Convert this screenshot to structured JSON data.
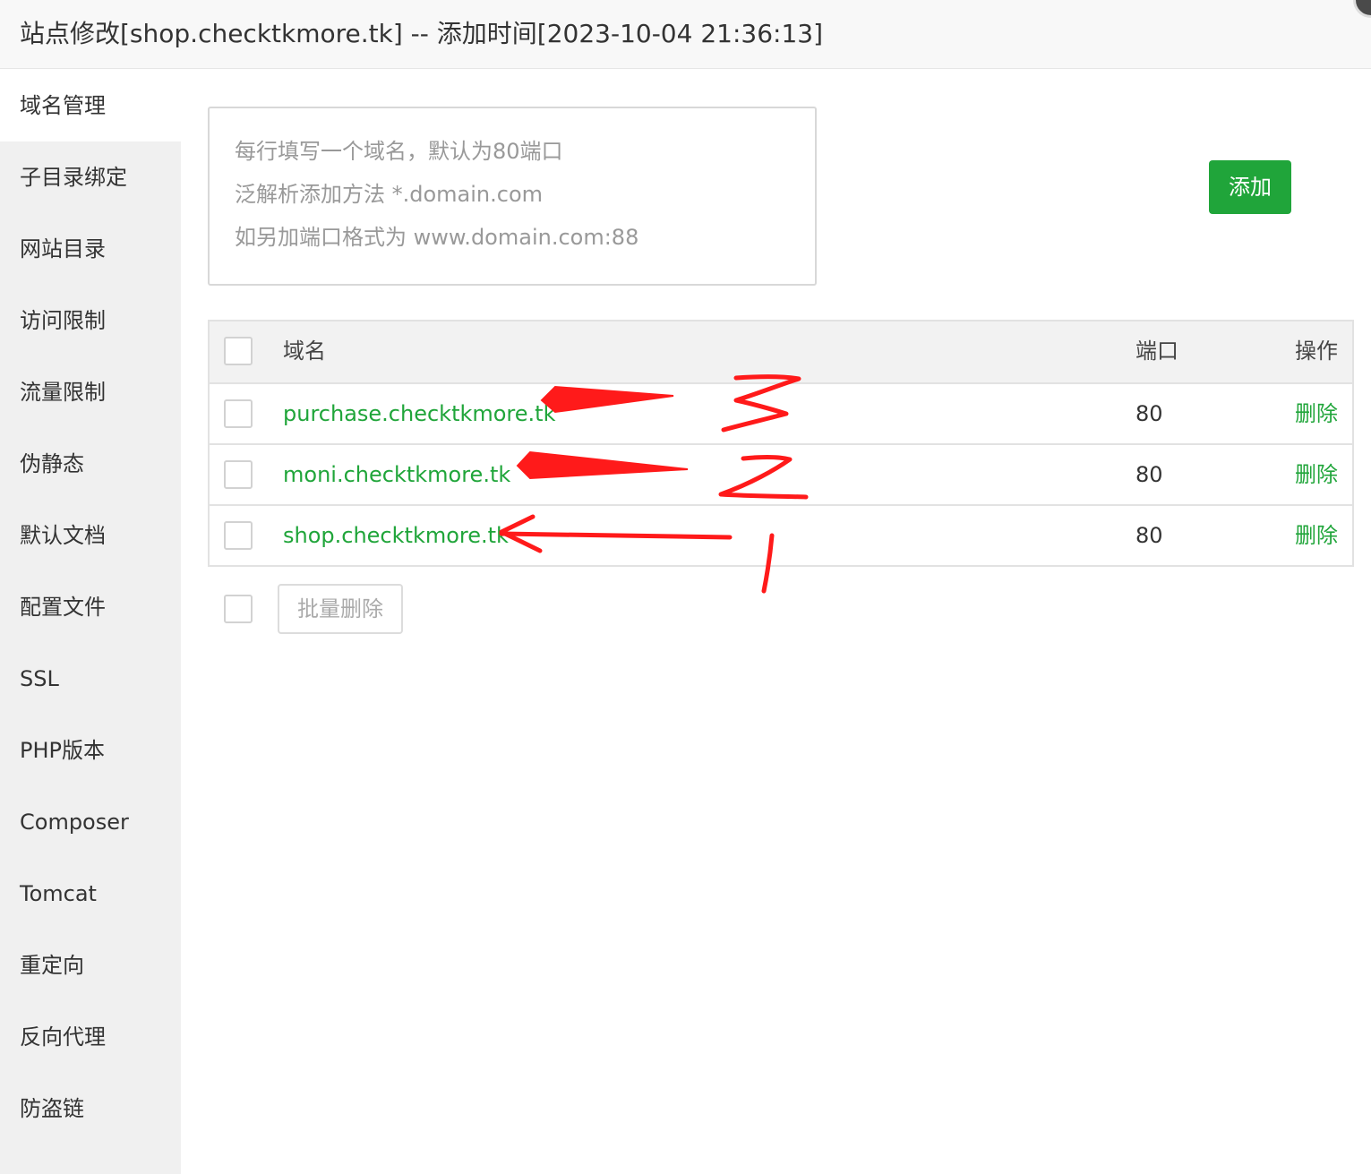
{
  "window": {
    "title": "站点修改[shop.checktkmore.tk] -- 添加时间[2023-10-04 21:36:13]"
  },
  "sidebar": {
    "items": [
      {
        "label": "域名管理",
        "active": true
      },
      {
        "label": "子目录绑定"
      },
      {
        "label": "网站目录"
      },
      {
        "label": "访问限制"
      },
      {
        "label": "流量限制"
      },
      {
        "label": "伪静态"
      },
      {
        "label": "默认文档"
      },
      {
        "label": "配置文件"
      },
      {
        "label": "SSL"
      },
      {
        "label": "PHP版本"
      },
      {
        "label": "Composer"
      },
      {
        "label": "Tomcat"
      },
      {
        "label": "重定向"
      },
      {
        "label": "反向代理"
      },
      {
        "label": "防盗链"
      }
    ]
  },
  "domain_input": {
    "placeholder_lines": [
      "每行填写一个域名，默认为80端口",
      "泛解析添加方法 *.domain.com",
      "如另加端口格式为 www.domain.com:88"
    ]
  },
  "add_button": {
    "label": "添加"
  },
  "table": {
    "headers": {
      "domain": "域名",
      "port": "端口",
      "action": "操作"
    },
    "rows": [
      {
        "domain": "purchase.checktkmore.tk",
        "port": "80",
        "action": "删除"
      },
      {
        "domain": "moni.checktkmore.tk",
        "port": "80",
        "action": "删除"
      },
      {
        "domain": "shop.checktkmore.tk",
        "port": "80",
        "action": "删除"
      }
    ]
  },
  "batch_delete": {
    "label": "批量删除"
  },
  "colors": {
    "accent": "#20a53a",
    "annotation": "#ff1a1a",
    "sidebar_bg": "#f0f0f0"
  }
}
